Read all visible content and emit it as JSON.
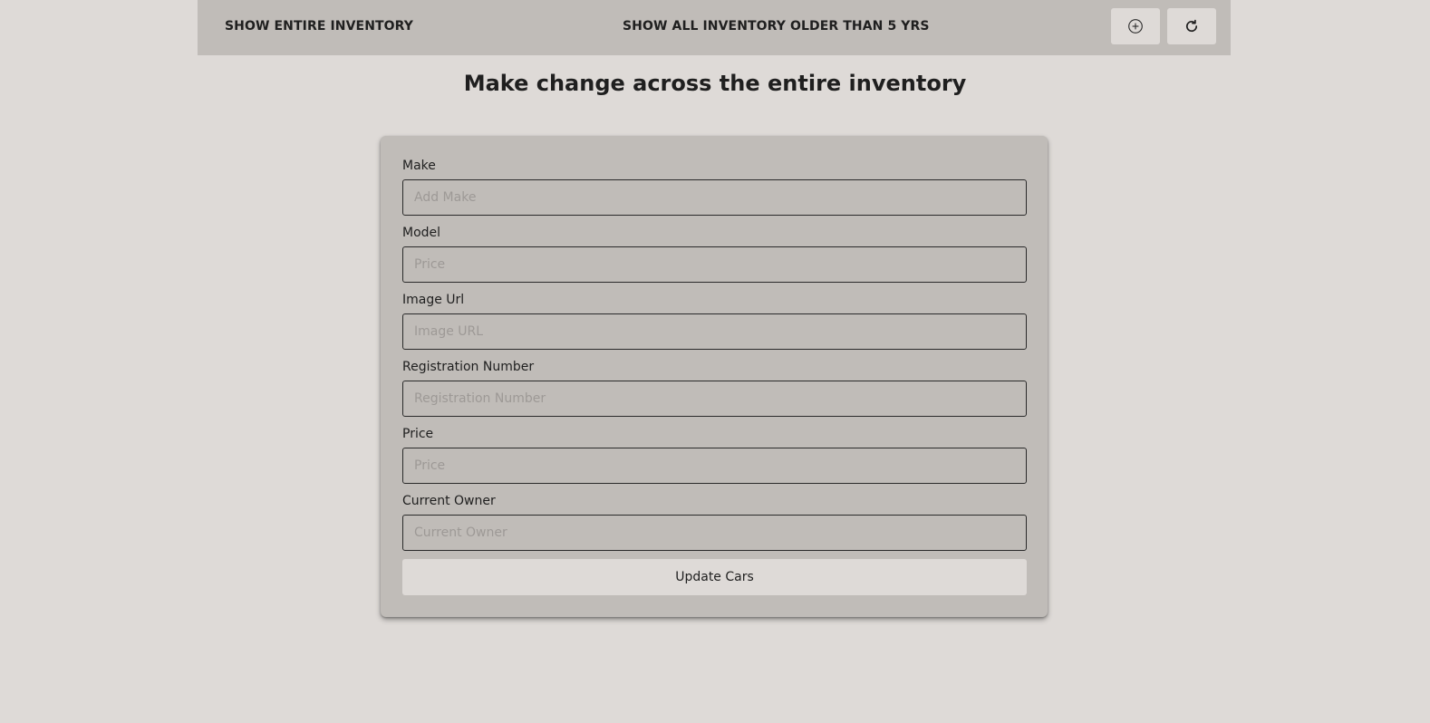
{
  "navbar": {
    "show_entire_inventory": "SHOW ENTIRE INVENTORY",
    "show_older_than": "SHOW ALL INVENTORY OLDER THAN 5 YRS",
    "add_icon": "add-circle-icon",
    "refresh_icon": "refresh-icon"
  },
  "page": {
    "title": "Make change across the entire inventory"
  },
  "form": {
    "fields": [
      {
        "label": "Make",
        "placeholder": "Add Make",
        "value": ""
      },
      {
        "label": "Model",
        "placeholder": "Price",
        "value": ""
      },
      {
        "label": "Image Url",
        "placeholder": "Image URL",
        "value": ""
      },
      {
        "label": "Registration Number",
        "placeholder": "Registration Number",
        "value": ""
      },
      {
        "label": "Price",
        "placeholder": "Price",
        "value": ""
      },
      {
        "label": "Current Owner",
        "placeholder": "Current Owner",
        "value": ""
      }
    ],
    "submit_label": "Update Cars"
  },
  "colors": {
    "background": "#dedad7",
    "navbar": "#c0bcb8",
    "card": "#c0bcb8",
    "text": "#1f1f1f"
  }
}
